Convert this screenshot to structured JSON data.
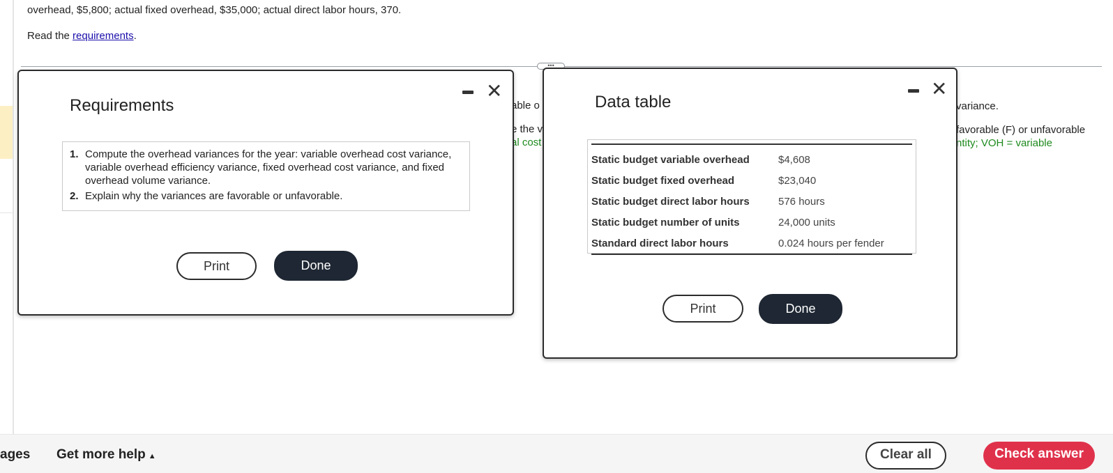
{
  "problem": {
    "text": "overhead, $5,800; actual fixed overhead, $35,000; actual direct labor hours, 370.",
    "read_prefix": "Read the ",
    "read_link": "requirements",
    "read_suffix": "."
  },
  "background_fragments": {
    "left_col": [
      "able o",
      "e the v",
      "al cost"
    ],
    "right_col": [
      "variance.",
      "favorable (F) or unfavorable",
      "ntity; VOH = variable"
    ]
  },
  "requirements_dialog": {
    "title": "Requirements",
    "items": [
      {
        "num": "1.",
        "text": "Compute the overhead variances for the year: variable overhead cost variance, variable overhead efficiency variance, fixed overhead cost variance, and fixed overhead volume variance."
      },
      {
        "num": "2.",
        "text": "Explain why the variances are favorable or unfavorable."
      }
    ],
    "print_label": "Print",
    "done_label": "Done",
    "close_glyph": "✕"
  },
  "data_dialog": {
    "title": "Data table",
    "rows": [
      {
        "label": "Static budget variable overhead",
        "value": "$4,608"
      },
      {
        "label": "Static budget fixed overhead",
        "value": "$23,040"
      },
      {
        "label": "Static budget direct labor hours",
        "value": "576 hours"
      },
      {
        "label": "Static budget number of units",
        "value": "24,000 units"
      },
      {
        "label": "Standard direct labor hours",
        "value": "0.024 hours per fender"
      }
    ],
    "print_label": "Print",
    "done_label": "Done",
    "close_glyph": "✕"
  },
  "divider_handle": "•••",
  "bottom_bar": {
    "left_fragment": "ages",
    "help_label": "Get more help",
    "help_caret": "▲",
    "clear_label": "Clear all",
    "check_label": "Check answer"
  },
  "colors": {
    "dark_button": "#1e2733",
    "check_button": "#e0314b",
    "link": "#1a0dab",
    "green_text": "#1e8a1e"
  }
}
